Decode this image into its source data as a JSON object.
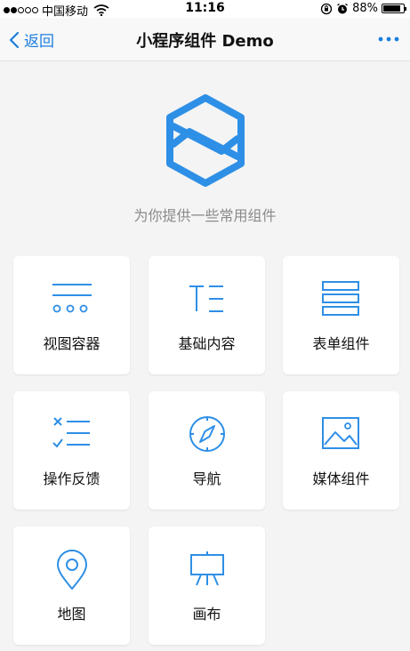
{
  "status_bar": {
    "carrier": "中国移动",
    "time": "11:16",
    "battery": "88%"
  },
  "nav": {
    "back_label": "返回",
    "title": "小程序组件 Demo"
  },
  "subtitle": "为你提供一些常用组件",
  "colors": {
    "accent": "#1c7ee0",
    "logo": "#2e8fe6"
  },
  "components": [
    {
      "label": "视图容器",
      "icon": "view-container-icon"
    },
    {
      "label": "基础内容",
      "icon": "basic-content-icon"
    },
    {
      "label": "表单组件",
      "icon": "form-icon"
    },
    {
      "label": "操作反馈",
      "icon": "feedback-icon"
    },
    {
      "label": "导航",
      "icon": "compass-icon"
    },
    {
      "label": "媒体组件",
      "icon": "image-icon"
    },
    {
      "label": "地图",
      "icon": "map-pin-icon"
    },
    {
      "label": "画布",
      "icon": "easel-icon"
    }
  ]
}
